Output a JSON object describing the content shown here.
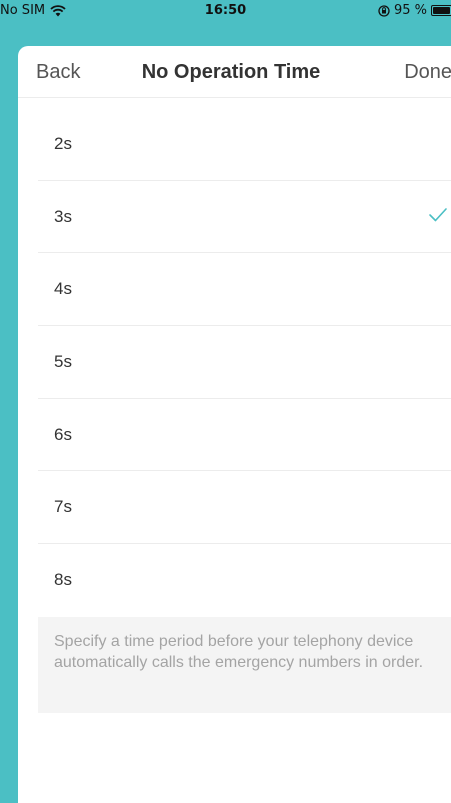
{
  "status_bar": {
    "carrier": "No SIM",
    "time": "16:50",
    "battery_text": "95 %",
    "battery_level": 0.95
  },
  "nav": {
    "back_label": "Back",
    "title": "No Operation Time",
    "done_label": "Done"
  },
  "options": [
    {
      "label": "2s",
      "selected": false
    },
    {
      "label": "3s",
      "selected": true
    },
    {
      "label": "4s",
      "selected": false
    },
    {
      "label": "5s",
      "selected": false
    },
    {
      "label": "6s",
      "selected": false
    },
    {
      "label": "7s",
      "selected": false
    },
    {
      "label": "8s",
      "selected": false
    }
  ],
  "footer": {
    "note": "Specify a time period before your telephony device automatically calls the emergency numbers in order."
  },
  "colors": {
    "accent": "#4bbfc4",
    "check": "#4bbfc4"
  },
  "icons": {
    "wifi": "wifi-icon",
    "lock": "orientation-lock-icon",
    "battery": "battery-icon",
    "check": "checkmark-icon"
  }
}
